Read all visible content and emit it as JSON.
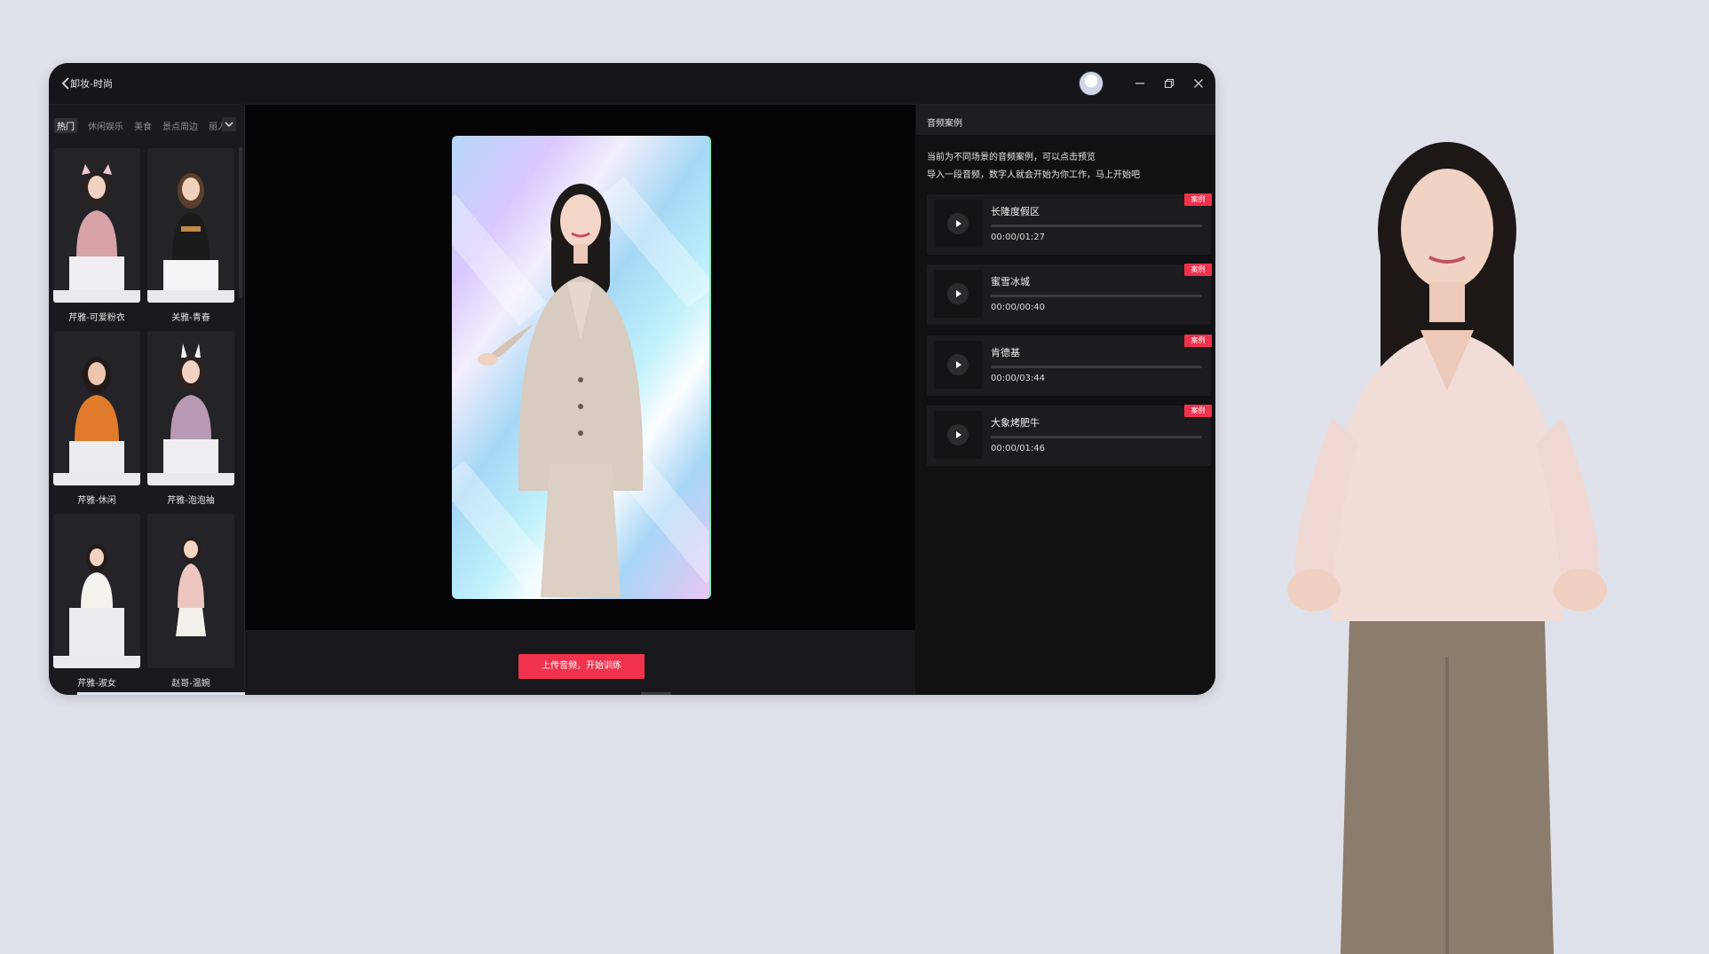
{
  "window": {
    "title": "卸妆-时尚",
    "controls": [
      "minimize-icon",
      "restore-icon",
      "close-icon"
    ]
  },
  "left_panel": {
    "tabs": [
      {
        "label": "热门",
        "active": true
      },
      {
        "label": "休闲娱乐",
        "active": false
      },
      {
        "label": "美食",
        "active": false
      },
      {
        "label": "景点周边",
        "active": false
      },
      {
        "label": "丽人",
        "active": false
      }
    ],
    "avatars": [
      {
        "name": "芹雅-可爱粉衣"
      },
      {
        "name": "关雅-青春"
      },
      {
        "name": "芹雅-休闲"
      },
      {
        "name": "芹雅-泡泡袖"
      },
      {
        "name": "芹雅-淑女"
      },
      {
        "name": "赵哥-温婉"
      }
    ]
  },
  "center": {
    "action_button": "上传音频，开始训练"
  },
  "right_panel": {
    "title": "音频案例",
    "description_lines": [
      "当前为不同场景的音频案例，可以点击预览",
      "导入一段音频，数字人就会开始为你工作，马上开始吧"
    ],
    "badge_label": "案例",
    "audio_items": [
      {
        "name": "长隆度假区",
        "time": "00:00/01:27",
        "progress": 0
      },
      {
        "name": "蜜雪冰城",
        "time": "00:00/00:40",
        "progress": 0
      },
      {
        "name": "肯德基",
        "time": "00:00/03:44",
        "progress": 0
      },
      {
        "name": "大象烤肥牛",
        "time": "00:00/01:46",
        "progress": 0
      }
    ]
  },
  "colors": {
    "accent": "#f0324d",
    "page_background": "#dfe1ea",
    "app_background": "#111114"
  }
}
